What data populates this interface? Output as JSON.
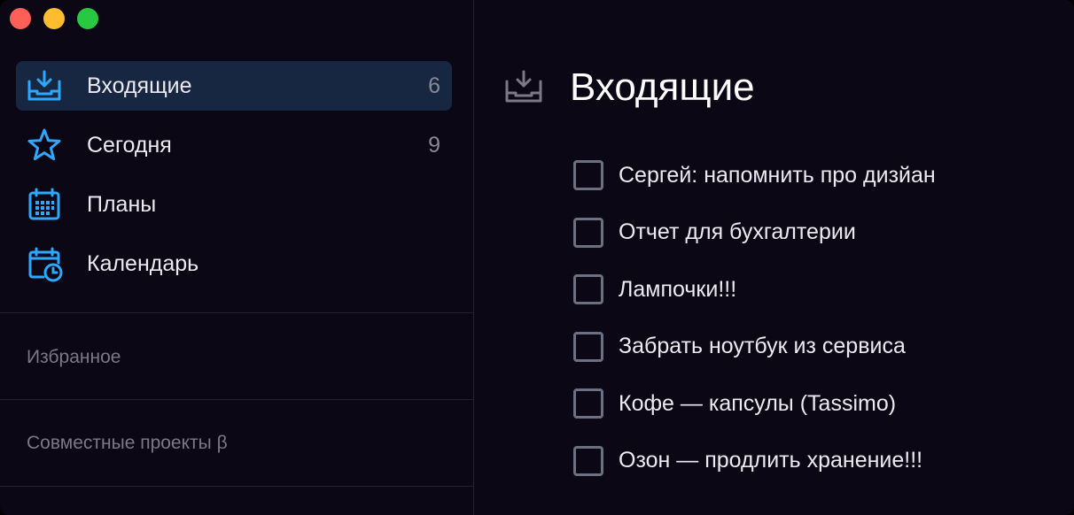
{
  "window": {
    "traffic_lights": [
      "close",
      "minimize",
      "maximize"
    ]
  },
  "sidebar": {
    "items": [
      {
        "label": "Входящие",
        "count": "6",
        "icon": "inbox-icon",
        "selected": true
      },
      {
        "label": "Сегодня",
        "count": "9",
        "icon": "star-icon",
        "selected": false
      },
      {
        "label": "Планы",
        "count": "",
        "icon": "calendar-grid-icon",
        "selected": false
      },
      {
        "label": "Календарь",
        "count": "",
        "icon": "calendar-clock-icon",
        "selected": false
      }
    ],
    "sections": {
      "favorites": "Избранное",
      "shared_projects": "Совместные проекты β"
    }
  },
  "main": {
    "title": "Входящие",
    "title_icon": "inbox-icon",
    "tasks": [
      {
        "text": "Сергей: напомнить про дизйан",
        "checked": false
      },
      {
        "text": "Отчет для бухгалтерии",
        "checked": false
      },
      {
        "text": "Лампочки!!!",
        "checked": false
      },
      {
        "text": "Забрать ноутбук из сервиса",
        "checked": false
      },
      {
        "text": "Кофе — капсулы (Tassimo)",
        "checked": false
      },
      {
        "text": "Озон — продлить хранение!!!",
        "checked": false
      }
    ]
  },
  "colors": {
    "background": "#0b0715",
    "accent": "#2ea8ff",
    "selected_row": "#172741",
    "checkbox_border": "#6b7180",
    "muted_text": "#7b7986"
  }
}
